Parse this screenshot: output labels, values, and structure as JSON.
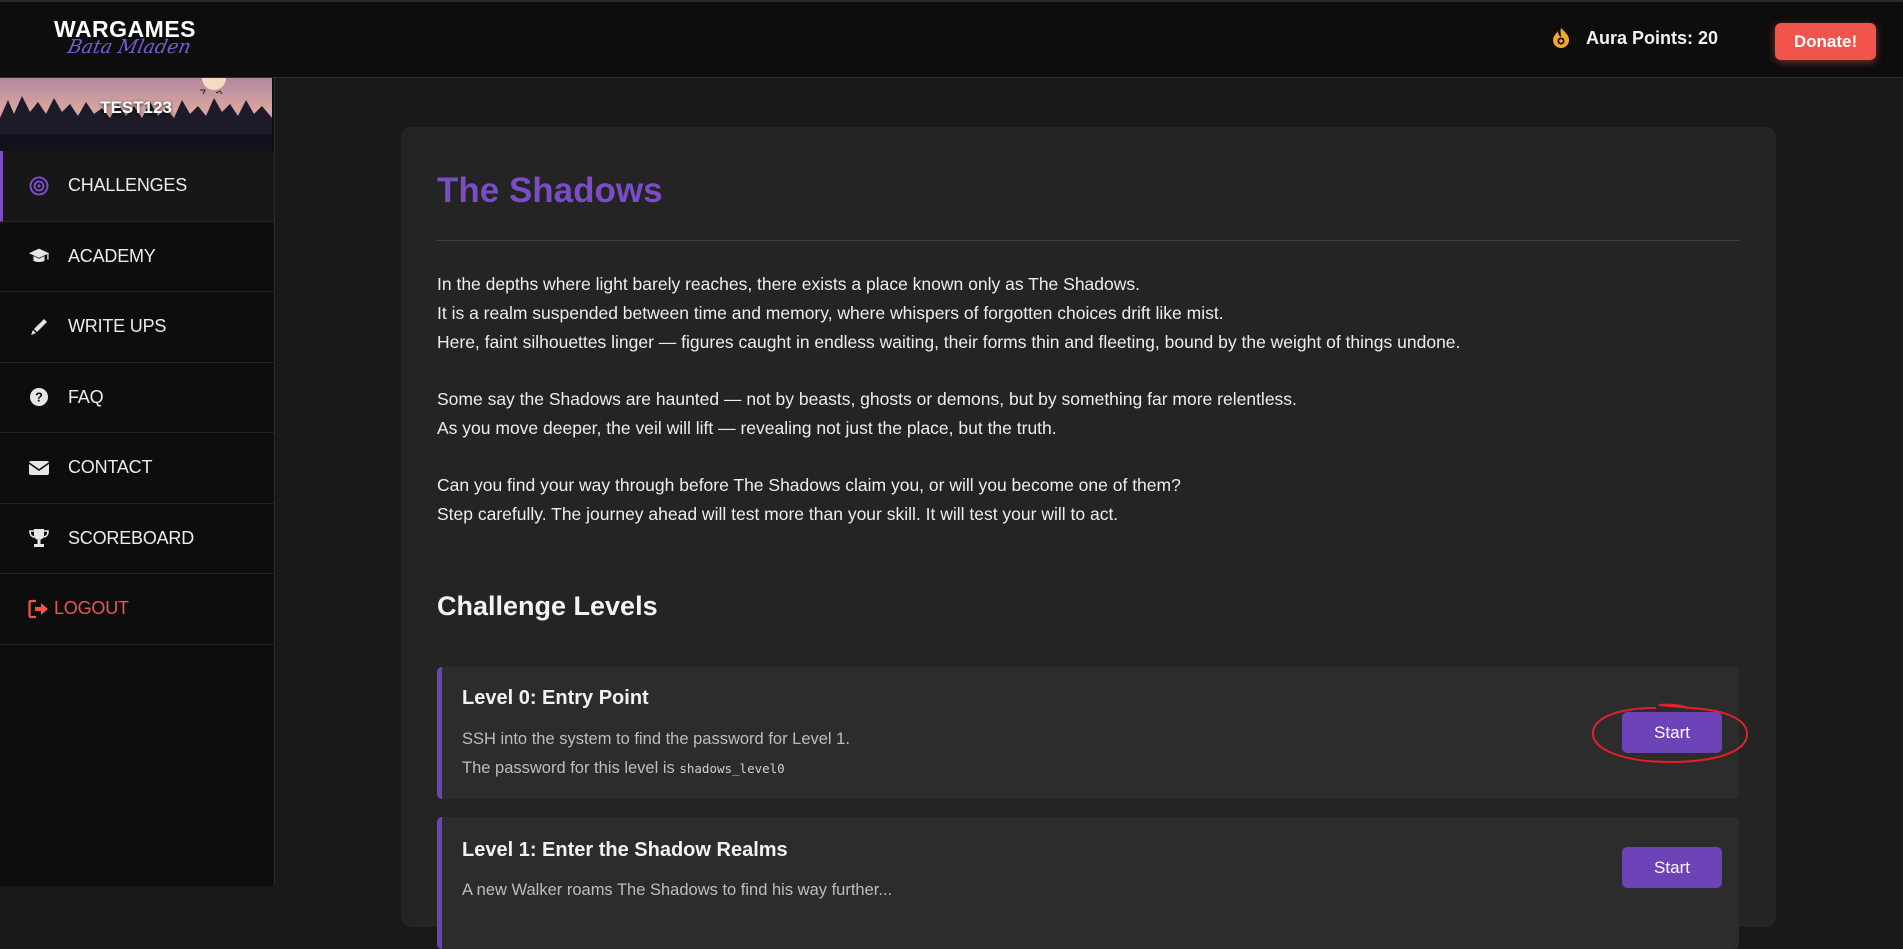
{
  "header": {
    "logo_main": "WARGAMES",
    "logo_sub": "Bata Mladen",
    "aura_label": "Aura Points: 20",
    "donate_label": "Donate!"
  },
  "sidebar": {
    "username": "TEST123",
    "items": [
      {
        "label": "CHALLENGES",
        "icon": "target-icon",
        "active": true
      },
      {
        "label": "ACADEMY",
        "icon": "graduation-cap-icon"
      },
      {
        "label": "WRITE UPS",
        "icon": "pen-icon"
      },
      {
        "label": "FAQ",
        "icon": "question-circle-icon"
      },
      {
        "label": "CONTACT",
        "icon": "envelope-icon"
      },
      {
        "label": "SCOREBOARD",
        "icon": "trophy-icon"
      },
      {
        "label": "LOGOUT",
        "icon": "sign-out-icon"
      }
    ]
  },
  "main": {
    "title": "The Shadows",
    "paragraphs": [
      [
        "In the depths where light barely reaches, there exists a place known only as The Shadows.",
        "It is a realm suspended between time and memory, where whispers of forgotten choices drift like mist.",
        "Here, faint silhouettes linger — figures caught in endless waiting, their forms thin and fleeting, bound by the weight of things undone."
      ],
      [
        "Some say the Shadows are haunted — not by beasts, ghosts or demons, but by something far more relentless.",
        "As you move deeper, the veil will lift — revealing not just the place, but the truth."
      ],
      [
        "Can you find your way through before The Shadows claim you, or will you become one of them?",
        "Step carefully. The journey ahead will test more than your skill. It will test your will to act."
      ]
    ],
    "section_title": "Challenge Levels",
    "levels": [
      {
        "title": "Level 0: Entry Point",
        "line1": "SSH into the system to find the password for Level 1.",
        "line2_prefix": "The password for this level is ",
        "line2_code": "shadows_level0",
        "button": "Start"
      },
      {
        "title": "Level 1: Enter the Shadow Realms",
        "line1": "A new Walker roams The Shadows to find his way further...",
        "button": "Start"
      }
    ]
  },
  "colors": {
    "accent": "#7b4cc4",
    "donate": "#f0544a",
    "background": "#191919",
    "card": "#242424",
    "annotation": "#e0202a"
  }
}
